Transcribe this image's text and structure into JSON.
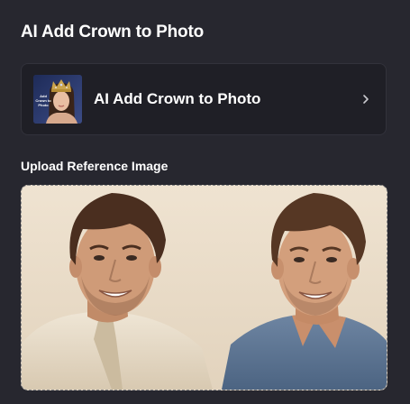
{
  "panel": {
    "title": "AI Add Crown to Photo"
  },
  "template_card": {
    "label": "AI Add Crown to Photo",
    "thumbnail_caption": "Add Crown to Photo",
    "icon": "chevron-right-icon"
  },
  "upload": {
    "label": "Upload Reference Image",
    "image": "two smiling men portrait"
  },
  "colors": {
    "background": "#27272f",
    "card_background": "#1f1f26",
    "text": "#ffffff",
    "upload_border": "#8a8a8a"
  }
}
